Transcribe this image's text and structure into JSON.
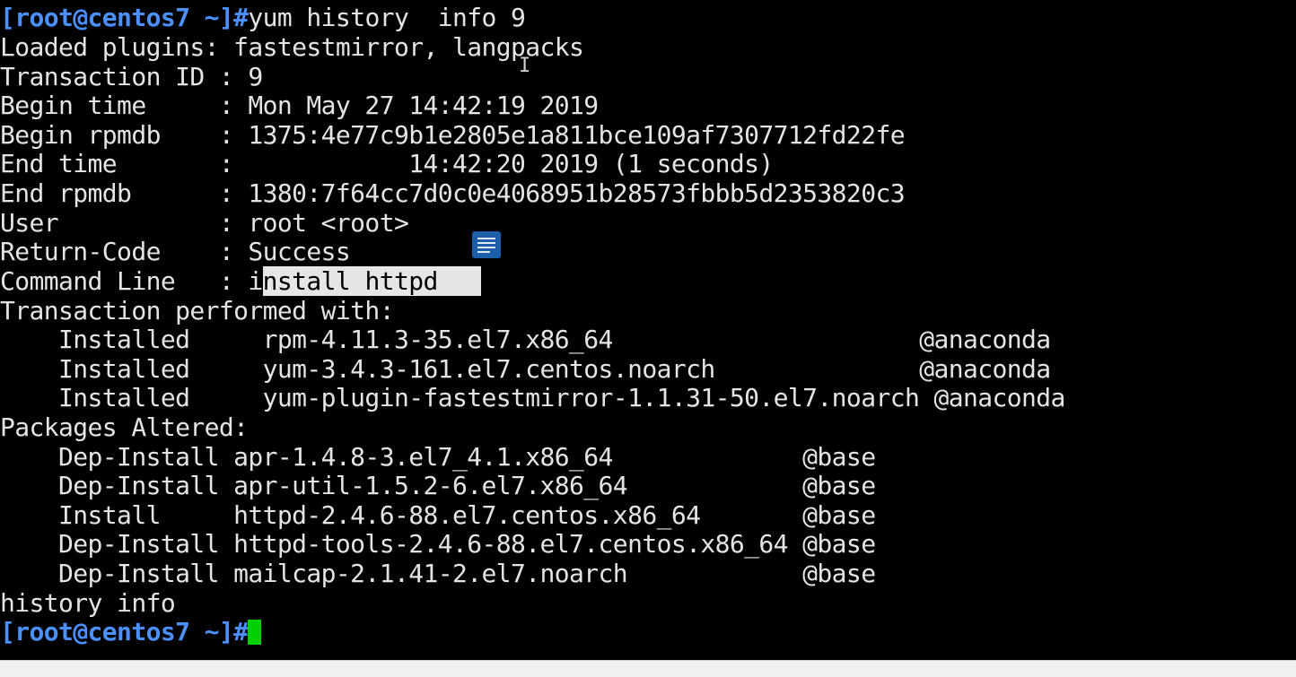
{
  "terminal": {
    "prompt_text": "[root@centos7 ~]#",
    "command": "yum history  info 9",
    "lines": [
      "Loaded plugins: fastestmirror, langpacks",
      "Transaction ID : 9",
      "Begin time     : Mon May 27 14:42:19 2019",
      "Begin rpmdb    : 1375:4e77c9b1e2805e1a811bce109af7307712fd22fe",
      "End time       :            14:42:20 2019 (1 seconds)",
      "End rpmdb      : 1380:7f64cc7d0c0e4068951b28573fbbb5d2353820c3",
      "User           : root <root>",
      "Return-Code    : Success"
    ],
    "command_line_label": "Command Line   : i",
    "command_line_selected": "nstall httpd",
    "lines2": [
      "Transaction performed with:",
      "    Installed     rpm-4.11.3-35.el7.x86_64                     @anaconda",
      "    Installed     yum-3.4.3-161.el7.centos.noarch              @anaconda",
      "    Installed     yum-plugin-fastestmirror-1.1.31-50.el7.noarch @anaconda",
      "Packages Altered:",
      "    Dep-Install apr-1.4.8-3.el7_4.1.x86_64             @base",
      "    Dep-Install apr-util-1.5.2-6.el7.x86_64            @base",
      "    Install     httpd-2.4.6-88.el7.centos.x86_64       @base",
      "    Dep-Install httpd-tools-2.4.6-88.el7.centos.x86_64 @base",
      "    Dep-Install mailcap-2.1.41-2.el7.noarch            @base",
      "history info"
    ],
    "final_prompt": "[root@centos7 ~]#"
  },
  "icons": {
    "doc_icon": "document-icon",
    "pointer": "text-cursor-icon"
  },
  "colors": {
    "background": "#000000",
    "text": "#e4e4e4",
    "prompt": "#4a90ff",
    "cursor": "#00d000",
    "selection": "#e6e6e6"
  }
}
